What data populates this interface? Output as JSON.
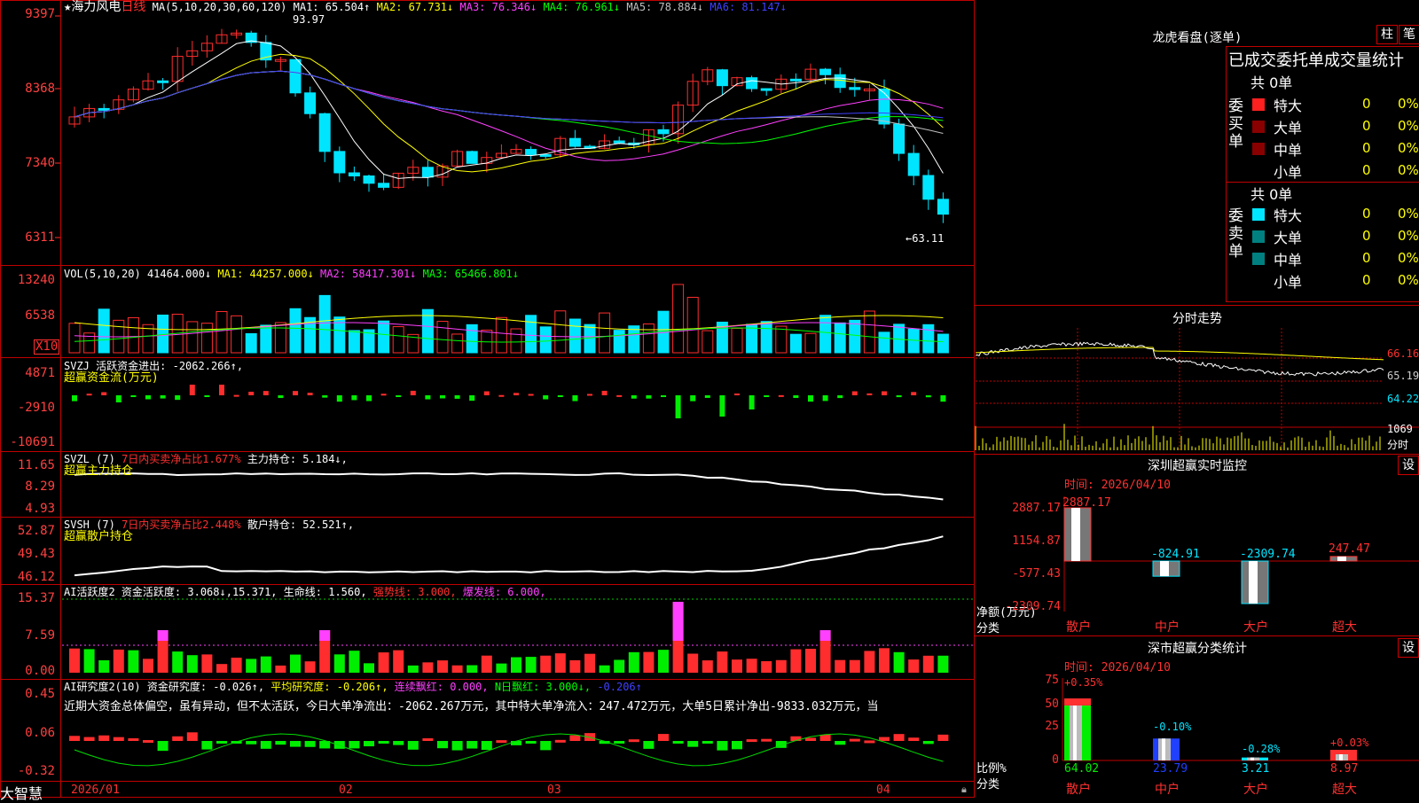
{
  "colors": {
    "up": "#ff2d2d",
    "down": "#00e5ff",
    "grid": "#c00000",
    "ma1": "#ffffff",
    "ma2": "#ffff00",
    "ma3": "#ff40ff",
    "ma4": "#00ff00",
    "ma5": "#c0c0c0",
    "ma6": "#4040ff"
  },
  "main": {
    "title_prefix": "★海力风电",
    "title_period": "日线",
    "ma_label": "MA(5,10,20,30,60,120)",
    "ma_values": [
      "MA1: 65.504↑",
      "MA2: 67.731↓",
      "MA3: 76.346↓",
      "MA4: 76.961↓",
      "MA5: 78.884↓",
      "MA6: 81.147↓"
    ],
    "y_ticks": [
      "9397",
      "8368",
      "7340",
      "6311"
    ],
    "high_marker": "93.97",
    "low_marker": "←63.11"
  },
  "vol": {
    "label": "VOL(5,10,20)",
    "value": "41464.000↓",
    "ma1": "MA1: 44257.000↓",
    "ma2": "MA2: 58417.301↓",
    "ma3": "MA3: 65466.801↓",
    "y_ticks": [
      "13240",
      "6538"
    ],
    "unit": "X10"
  },
  "svzj": {
    "label": "SVZJ",
    "line1": "活跃资金进出: -2062.266↑,",
    "line2": "超赢资金流(万元)",
    "y_ticks": [
      "4871",
      "-2910",
      "-10691"
    ]
  },
  "svzl": {
    "label": "SVZL (7)",
    "ratio": "7日内买卖净占比1.677%",
    "hold": "主力持仓: 5.184↓,",
    "line2": "超赢主力持仓",
    "y_ticks": [
      "11.65",
      "8.29",
      "4.93"
    ]
  },
  "svsh": {
    "label": "SVSH (7)",
    "ratio": "7日内买卖净占比2.448%",
    "hold": "散户持仓: 52.521↑,",
    "line2": "超赢散户持仓",
    "y_ticks": [
      "52.87",
      "49.43",
      "46.12"
    ]
  },
  "ai": {
    "label": "AI活跃度2",
    "act": "资金活跃度: 3.068↓,15.371,",
    "life": "生命线: 1.560,",
    "strong": "强势线: 3.000,",
    "burst": "爆发线: 6.000,",
    "y_ticks": [
      "15.37",
      "7.59",
      "0.00"
    ]
  },
  "research": {
    "label": "AI研究度2(10)",
    "res": "资金研究度: -0.026↑,",
    "avg": "平均研究度: -0.206↑,",
    "cont": "连续飘红: 0.000,",
    "nday": "N日飘红: 3.000↓,",
    "tail": "-0.206↑",
    "text": "近期大资金总体偏空，虽有异动，但不太活跃，今日大单净流出：-2062.267万元，其中特大单净流入：247.472万元，大单5日累计净出-9833.032万元，当",
    "y_ticks": [
      "0.45",
      "0.06",
      "-0.32"
    ]
  },
  "dates": {
    "d1": "2026/01",
    "d2": "02",
    "d3": "03",
    "d4": "04"
  },
  "brand": "大智慧",
  "longhu": {
    "title": "龙虎看盘(逐单)",
    "btn1": "柱",
    "btn2": "笔",
    "subtitle": "已成交委托单成交量统计",
    "buy_label": "委买单",
    "sell_label": "委卖单",
    "buy_count": "共 0单",
    "sell_count": "共 0单",
    "buy_rows": [
      {
        "name": "特大",
        "qty": "0",
        "pct": "0%"
      },
      {
        "name": "大单",
        "qty": "0",
        "pct": "0%"
      },
      {
        "name": "中单",
        "qty": "0",
        "pct": "0%"
      },
      {
        "name": "小单",
        "qty": "0",
        "pct": "0%"
      }
    ],
    "sell_rows": [
      {
        "name": "特大",
        "qty": "0",
        "pct": "0%"
      },
      {
        "name": "大单",
        "qty": "0",
        "pct": "0%"
      },
      {
        "name": "中单",
        "qty": "0",
        "pct": "0%"
      },
      {
        "name": "小单",
        "qty": "0",
        "pct": "0%"
      }
    ]
  },
  "intraday": {
    "title": "分时走势",
    "y_ticks": [
      "66.16",
      "65.19",
      "64.22"
    ],
    "vol_label": "1069",
    "vol_unit": "分时"
  },
  "monitor": {
    "title": "深圳超赢实时监控",
    "btn": "设",
    "time": "时间: 2026/04/10",
    "y_ticks": [
      "2887.17",
      "1154.87",
      "-577.43",
      "-2309.74"
    ],
    "bars": [
      {
        "name": "散户",
        "val": "2887.17"
      },
      {
        "name": "中户",
        "val": "-824.91"
      },
      {
        "name": "大户",
        "val": "-2309.74"
      },
      {
        "name": "超大",
        "val": "247.47"
      }
    ],
    "ylabel": "净额(万元)",
    "xlabel": "分类"
  },
  "classify": {
    "title": "深市超赢分类统计",
    "btn": "设",
    "time": "时间: 2026/04/10",
    "y_ticks": [
      "75",
      "50",
      "25",
      "0"
    ],
    "bars": [
      {
        "name": "散户",
        "top": "+0.35%",
        "bottom": "64.02"
      },
      {
        "name": "中户",
        "top": "-0.10%",
        "bottom": "23.79"
      },
      {
        "name": "大户",
        "top": "-0.28%",
        "bottom": "3.21"
      },
      {
        "name": "超大",
        "top": "+0.03%",
        "bottom": "8.97"
      }
    ],
    "ylabel": "比例%",
    "xlabel": "分类"
  }
}
